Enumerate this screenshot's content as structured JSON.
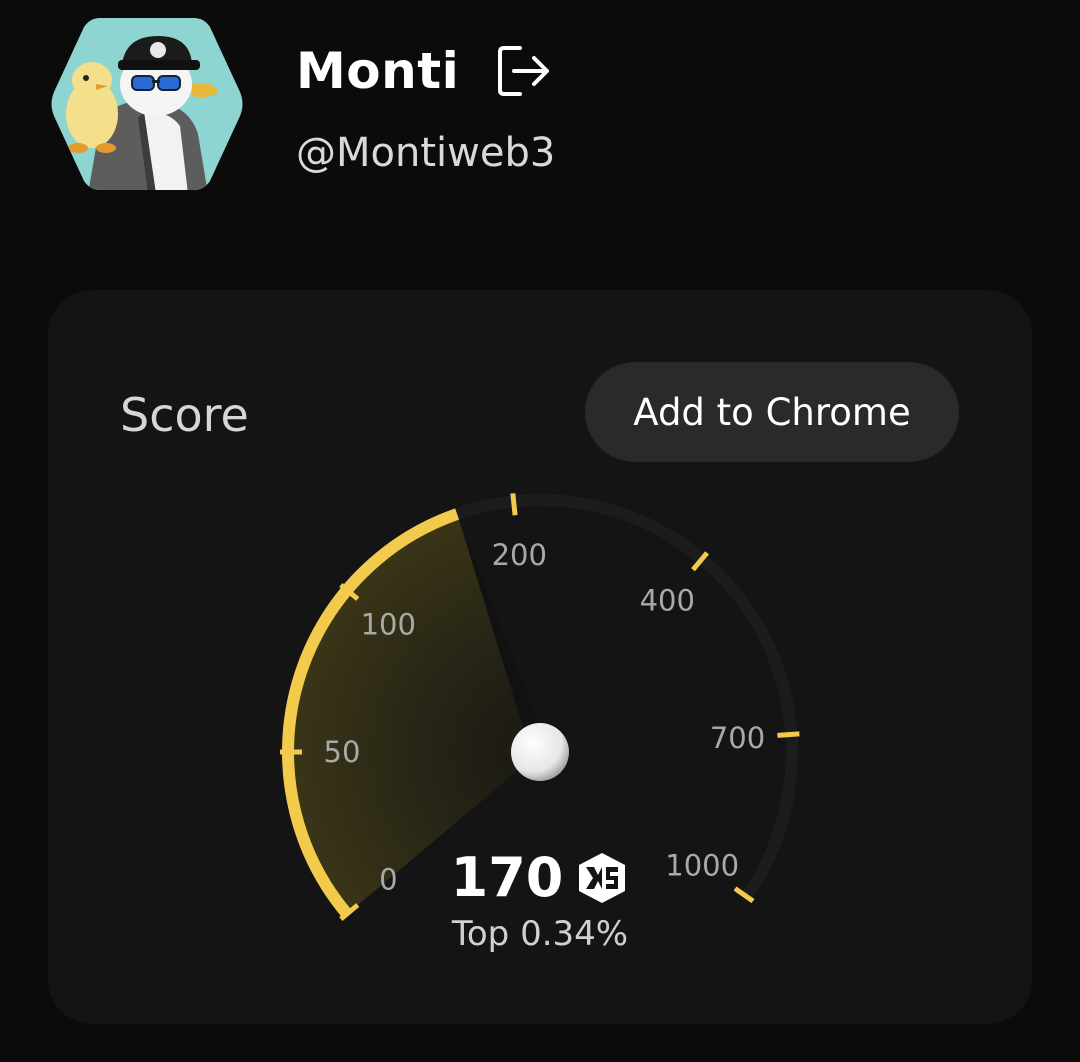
{
  "profile": {
    "name": "Monti",
    "handle": "@Montiweb3",
    "avatar_icon": "penguin-avatar",
    "logout_icon": "logout-icon"
  },
  "score_card": {
    "label": "Score",
    "add_button_label": "Add to Chrome",
    "value": "170",
    "badge_icon": "xs-logo-icon",
    "rank_text": "Top 0.34%",
    "accent_color": "#f2cb4c"
  },
  "gauge": {
    "ticks": [
      "0",
      "50",
      "100",
      "200",
      "400",
      "700",
      "1000"
    ],
    "score": 170
  }
}
